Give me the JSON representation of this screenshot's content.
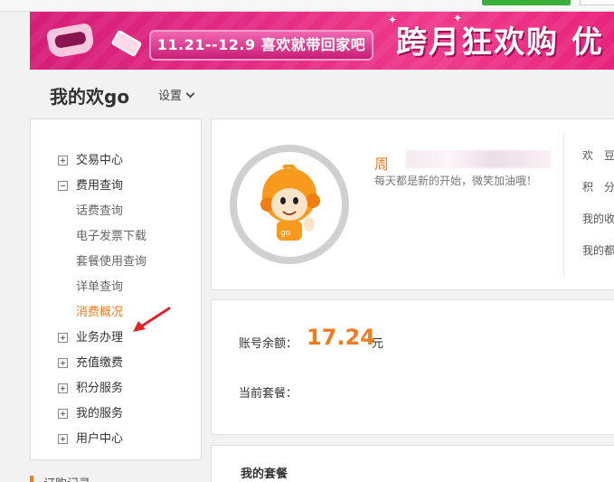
{
  "banner": {
    "date_pill": "11.21--12.9 喜欢就带回家吧",
    "headline": "跨月狂欢购 优"
  },
  "header": {
    "title": "我的欢go",
    "settings_label": "设置"
  },
  "sidebar": {
    "items": [
      {
        "label": "交易中心",
        "type": "top",
        "icon": "plus-icon"
      },
      {
        "label": "费用查询",
        "type": "top",
        "icon": "minus-icon"
      },
      {
        "label": "话费查询",
        "type": "sub"
      },
      {
        "label": "电子发票下载",
        "type": "sub"
      },
      {
        "label": "套餐使用查询",
        "type": "sub"
      },
      {
        "label": "详单查询",
        "type": "sub"
      },
      {
        "label": "消费概况",
        "type": "sub",
        "active": true
      },
      {
        "label": "业务办理",
        "type": "top",
        "icon": "plus-icon"
      },
      {
        "label": "充值缴费",
        "type": "top",
        "icon": "plus-icon"
      },
      {
        "label": "积分服务",
        "type": "top",
        "icon": "plus-icon"
      },
      {
        "label": "我的服务",
        "type": "top",
        "icon": "plus-icon"
      },
      {
        "label": "用户中心",
        "type": "top",
        "icon": "plus-icon"
      }
    ],
    "next_section_label": "订购记录"
  },
  "profile": {
    "name": "周",
    "motto": "每天都是新的开始，微笑加油哦！",
    "right_column": [
      "欢　豆",
      "积　分",
      "我的收",
      "我的都"
    ]
  },
  "balance": {
    "label": "账号余额：",
    "amount": "17.24",
    "unit": "元",
    "plan_label": "当前套餐："
  },
  "package": {
    "title": "我的套餐"
  },
  "colors": {
    "accent": "#f37a1f",
    "banner": "#e52b83"
  }
}
